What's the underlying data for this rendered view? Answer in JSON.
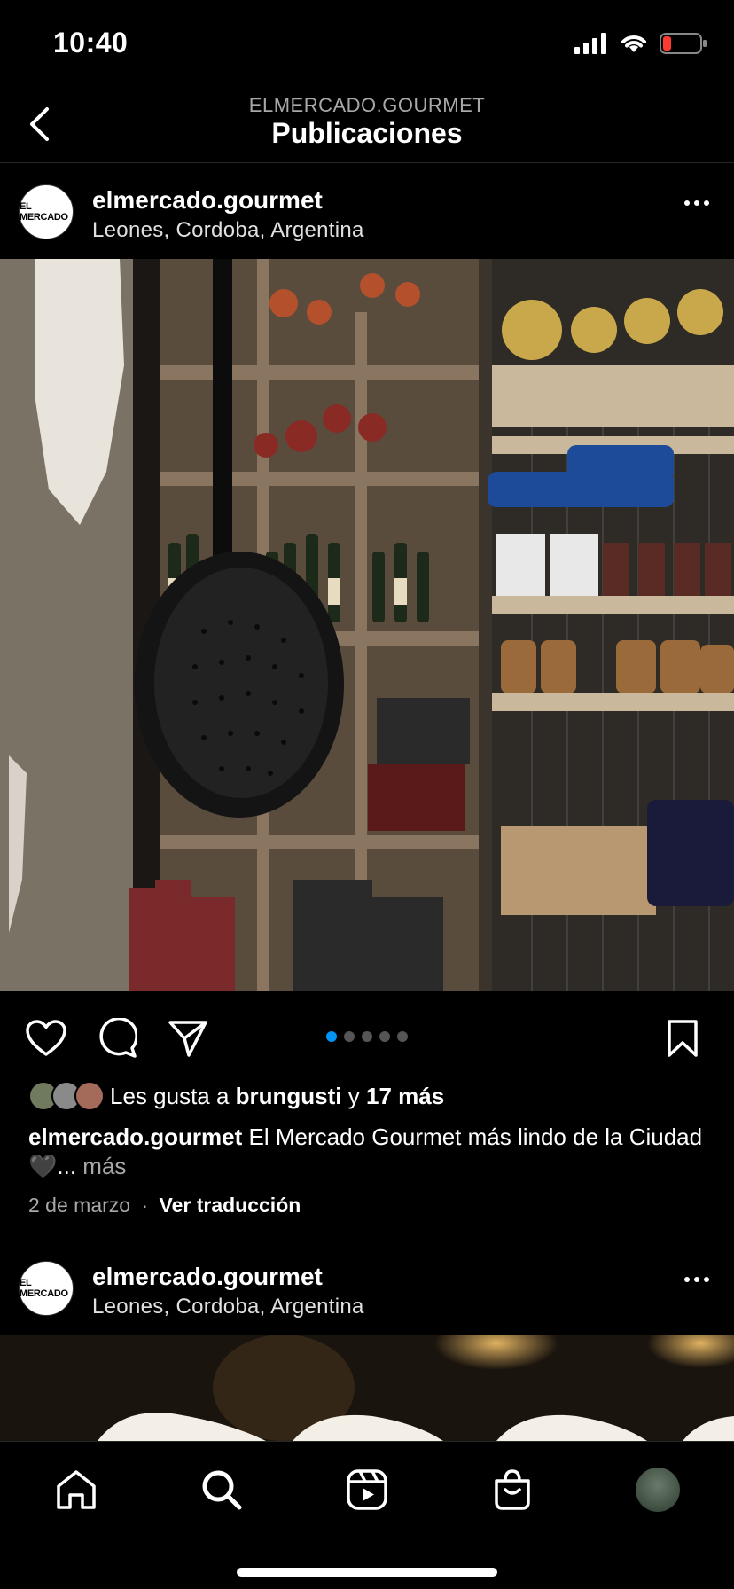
{
  "status": {
    "time": "10:40"
  },
  "header": {
    "account": "ELMERCADO.GOURMET",
    "title": "Publicaciones"
  },
  "post1": {
    "avatar_text": "EL MERCADO",
    "username": "elmercado.gourmet",
    "location": "Leones, Cordoba, Argentina",
    "carousel": {
      "count": 5,
      "active": 0
    },
    "likes": {
      "prefix": "Les gusta a ",
      "user": "brungusti",
      "mid": " y ",
      "others": "17 más"
    },
    "caption": {
      "username": "elmercado.gourmet",
      "text": " El Mercado Gourmet más lindo de la Ciudad 🖤",
      "ellipsis": "... ",
      "more": "más"
    },
    "date": "2 de marzo",
    "separator": "·",
    "translate": "Ver traducción"
  },
  "post2": {
    "avatar_text": "EL MERCADO",
    "username": "elmercado.gourmet",
    "location": "Leones, Cordoba, Argentina"
  },
  "colors": {
    "accent": "#0095f6",
    "background": "#000000",
    "muted": "#a8a8a8"
  },
  "icons": {
    "actions": [
      "heart-icon",
      "comment-icon",
      "share-icon",
      "bookmark-icon"
    ],
    "tabs": [
      "home-icon",
      "search-icon",
      "reels-icon",
      "shop-icon",
      "profile-avatar"
    ]
  }
}
